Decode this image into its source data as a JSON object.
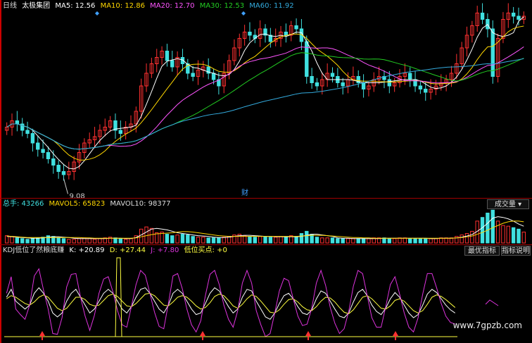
{
  "header": {
    "period": "日线",
    "name": "太极集团",
    "ma": [
      {
        "label": "MA5: 12.56",
        "color": "#ffffff"
      },
      {
        "label": "MA10: 12.86",
        "color": "#ffd700"
      },
      {
        "label": "MA20: 12.70",
        "color": "#ff55ff"
      },
      {
        "label": "MA30: 12.53",
        "color": "#22cc22"
      },
      {
        "label": "MA60: 11.92",
        "color": "#33aadd"
      }
    ]
  },
  "volume_legend": {
    "total": "总手: 43266",
    "mavol5": "MAVOL5: 65823",
    "mavol10": "MAVOL10: 98377"
  },
  "volume_button": "成交量",
  "kdj_legend": {
    "name": "KDJ低位了然粮底赚",
    "k": "K: +20.89",
    "d": "D: +27.44",
    "j": "J: +7.80",
    "buy": "低位买点: +0"
  },
  "buttons": {
    "best": "最优指标",
    "help": "指标说明"
  },
  "annotations": {
    "low": "9.08",
    "cai": "财"
  },
  "watermark": "www.7gpzb.com",
  "colors": {
    "up": "#ff3030",
    "down": "#40e0e0",
    "axis": "#a00000",
    "k": "#ffffff",
    "d": "#ffff40",
    "j": "#dd33dd",
    "volume_ma5": "#ffffff",
    "volume_ma10": "#ffd700",
    "buy_signal": "#ffff40",
    "arrow": "#ff3030"
  },
  "chart_data": [
    {
      "type": "candlestick",
      "title": "太极集团",
      "price_range": [
        8.6,
        14.4
      ],
      "low_label": 9.08,
      "closes": [
        10.7,
        10.9,
        10.8,
        10.6,
        10.5,
        10.2,
        10.0,
        9.9,
        9.7,
        9.5,
        9.3,
        9.2,
        9.3,
        9.6,
        9.9,
        10.2,
        10.3,
        10.4,
        10.6,
        10.7,
        10.9,
        10.6,
        10.5,
        10.7,
        10.8,
        11.2,
        12.0,
        12.4,
        12.7,
        12.9,
        13.1,
        12.8,
        12.6,
        12.9,
        12.7,
        12.4,
        12.3,
        12.5,
        12.6,
        12.4,
        12.2,
        12.0,
        12.4,
        12.8,
        13.2,
        13.5,
        13.7,
        13.6,
        13.5,
        13.8,
        13.6,
        13.4,
        13.5,
        13.7,
        13.6,
        13.9,
        13.8,
        13.4,
        12.3,
        12.1,
        12.0,
        12.2,
        12.4,
        12.3,
        12.1,
        12.0,
        12.2,
        12.3,
        12.1,
        11.9,
        12.0,
        12.2,
        12.3,
        12.2,
        12.0,
        12.1,
        12.3,
        12.4,
        12.2,
        12.0,
        11.9,
        11.8,
        11.9,
        12.0,
        12.1,
        12.2,
        12.4,
        12.7,
        13.2,
        13.6,
        13.9,
        14.3,
        14.1,
        13.8,
        12.3,
        13.5,
        14.1,
        14.3,
        14.2,
        14.1,
        14.2
      ]
    },
    {
      "type": "bar",
      "title": "成交量",
      "series": [
        {
          "name": "总手",
          "values": [
            20,
            18,
            14,
            12,
            10,
            12,
            14,
            16,
            20,
            18,
            14,
            12,
            10,
            10,
            12,
            14,
            12,
            10,
            12,
            14,
            16,
            14,
            12,
            10,
            12,
            20,
            38,
            44,
            40,
            28,
            30,
            24,
            20,
            22,
            24,
            22,
            18,
            16,
            16,
            14,
            14,
            14,
            16,
            18,
            22,
            24,
            20,
            18,
            16,
            18,
            18,
            16,
            16,
            18,
            16,
            20,
            18,
            26,
            32,
            24,
            16,
            14,
            14,
            14,
            12,
            12,
            12,
            12,
            12,
            12,
            12,
            14,
            14,
            14,
            12,
            12,
            14,
            14,
            12,
            12,
            12,
            12,
            12,
            12,
            14,
            14,
            14,
            18,
            22,
            26,
            32,
            60,
            70,
            82,
            90,
            60,
            48,
            46,
            42,
            38,
            30
          ]
        },
        {
          "name": "MAVOL5",
          "values": [
            18,
            17,
            16,
            15,
            14,
            13,
            13,
            14,
            16,
            17,
            17,
            16,
            15,
            13,
            12,
            12,
            12,
            12,
            12,
            12,
            13,
            13,
            13,
            12,
            12,
            15,
            22,
            30,
            38,
            40,
            38,
            36,
            32,
            28,
            26,
            24,
            22,
            20,
            19,
            18,
            16,
            15,
            15,
            16,
            18,
            20,
            21,
            21,
            20,
            19,
            18,
            18,
            17,
            17,
            17,
            17,
            17,
            18,
            21,
            24,
            24,
            22,
            20,
            18,
            14,
            13,
            13,
            12,
            12,
            12,
            12,
            12,
            12,
            13,
            13,
            13,
            13,
            13,
            13,
            13,
            13,
            13,
            12,
            12,
            13,
            13,
            13,
            14,
            16,
            19,
            23,
            32,
            42,
            54,
            68,
            72,
            70,
            66,
            60,
            52,
            46
          ]
        },
        {
          "name": "MAVOL10",
          "values": [
            19,
            18,
            17,
            16,
            15,
            15,
            15,
            15,
            15,
            15,
            15,
            15,
            15,
            15,
            15,
            14,
            14,
            13,
            13,
            13,
            13,
            13,
            13,
            13,
            13,
            14,
            17,
            20,
            23,
            25,
            26,
            27,
            28,
            30,
            31,
            31,
            30,
            28,
            26,
            24,
            22,
            20,
            19,
            18,
            18,
            18,
            18,
            18,
            18,
            18,
            18,
            18,
            18,
            18,
            18,
            18,
            18,
            19,
            20,
            21,
            21,
            21,
            20,
            19,
            18,
            17,
            16,
            15,
            15,
            14,
            14,
            13,
            13,
            13,
            13,
            13,
            13,
            13,
            13,
            13,
            13,
            13,
            13,
            13,
            13,
            13,
            13,
            14,
            15,
            17,
            19,
            24,
            29,
            35,
            42,
            48,
            54,
            58,
            60,
            60,
            58
          ]
        }
      ]
    },
    {
      "type": "line",
      "title": "KDJ",
      "series": [
        {
          "name": "K",
          "values": [
            50,
            60,
            45,
            40,
            35,
            40,
            55,
            62,
            55,
            45,
            30,
            25,
            30,
            45,
            55,
            60,
            50,
            40,
            30,
            35,
            45,
            55,
            60,
            55,
            45,
            35,
            30,
            38,
            50,
            60,
            62,
            55,
            45,
            35,
            30,
            40,
            55,
            60,
            55,
            45,
            35,
            28,
            30,
            42,
            55,
            62,
            58,
            48,
            38,
            30,
            35,
            50,
            60,
            58,
            45,
            35,
            25,
            22,
            30,
            42,
            52,
            55,
            48,
            38,
            30,
            28,
            34,
            48,
            58,
            55,
            45,
            35,
            26,
            24,
            30,
            44,
            56,
            60,
            52,
            40,
            32,
            28,
            36,
            48,
            56,
            50,
            40,
            30,
            24,
            28,
            40,
            54,
            60,
            56,
            48,
            40,
            34,
            30
          ]
        },
        {
          "name": "D",
          "values": [
            48,
            52,
            50,
            46,
            42,
            40,
            44,
            50,
            53,
            50,
            43,
            36,
            33,
            36,
            43,
            50,
            50,
            47,
            41,
            39,
            40,
            46,
            52,
            54,
            51,
            45,
            39,
            38,
            42,
            48,
            54,
            55,
            52,
            46,
            40,
            39,
            44,
            50,
            52,
            50,
            45,
            39,
            35,
            37,
            43,
            51,
            54,
            52,
            46,
            39,
            36,
            41,
            48,
            53,
            51,
            45,
            38,
            31,
            30,
            34,
            41,
            47,
            48,
            44,
            38,
            34,
            33,
            38,
            45,
            50,
            49,
            44,
            37,
            31,
            29,
            34,
            42,
            50,
            52,
            48,
            42,
            36,
            35,
            39,
            46,
            48,
            45,
            39,
            33,
            30,
            33,
            41,
            50,
            53,
            51,
            47,
            42,
            37
          ]
        },
        {
          "name": "J",
          "values": [
            55,
            76,
            35,
            28,
            22,
            40,
            77,
            86,
            59,
            35,
            4,
            3,
            24,
            63,
            79,
            80,
            50,
            26,
            8,
            27,
            55,
            73,
            76,
            57,
            33,
            15,
            12,
            38,
            66,
            84,
            78,
            55,
            31,
            13,
            10,
            42,
            77,
            80,
            61,
            35,
            15,
            6,
            20,
            52,
            79,
            84,
            66,
            40,
            22,
            12,
            33,
            68,
            84,
            68,
            33,
            15,
            0,
            4,
            30,
            58,
            74,
            71,
            48,
            26,
            14,
            16,
            36,
            68,
            84,
            65,
            37,
            17,
            4,
            10,
            32,
            64,
            84,
            80,
            52,
            24,
            12,
            12,
            38,
            66,
            76,
            54,
            30,
            12,
            6,
            24,
            54,
            80,
            80,
            62,
            42,
            26,
            18,
            16
          ]
        }
      ],
      "spike": {
        "index": 24,
        "value": 100
      }
    }
  ]
}
